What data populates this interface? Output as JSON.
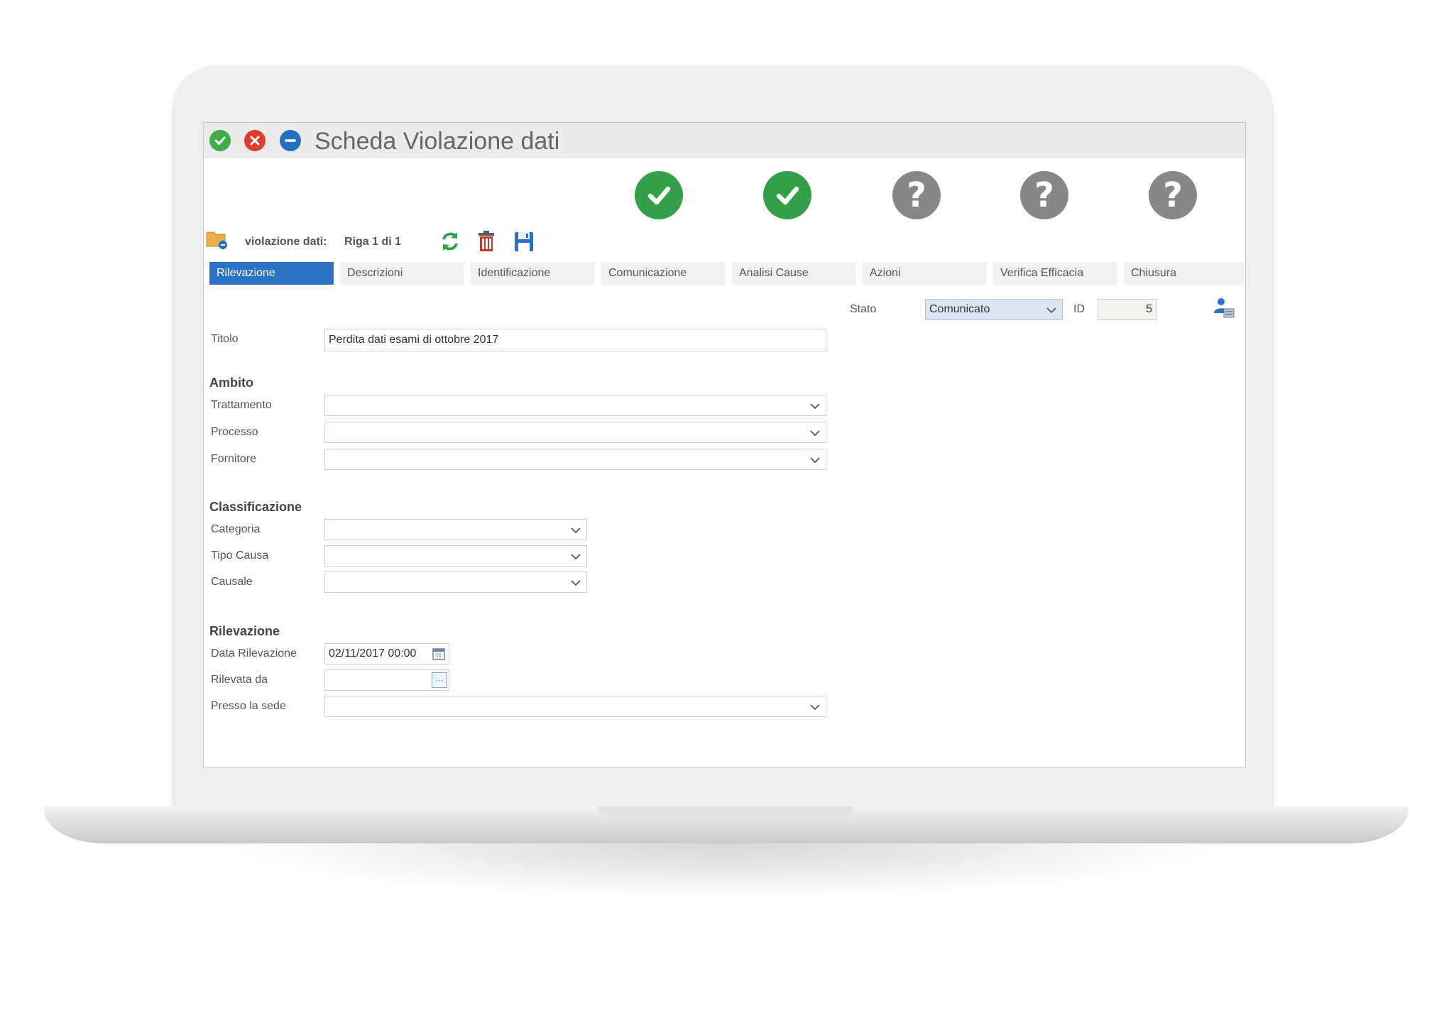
{
  "window": {
    "title": "Scheda Violazione dati"
  },
  "steps": [
    {
      "status": "done",
      "icon": "check-icon"
    },
    {
      "status": "done",
      "icon": "check-icon"
    },
    {
      "status": "todo",
      "icon": "question-icon",
      "glyph": "?"
    },
    {
      "status": "todo",
      "icon": "question-icon",
      "glyph": "?"
    },
    {
      "status": "todo",
      "icon": "question-icon",
      "glyph": "?"
    }
  ],
  "navigator": {
    "label": "violazione dati:",
    "record": "Riga 1 di 1"
  },
  "tabs": [
    {
      "label": "Rilevazione",
      "active": true
    },
    {
      "label": "Descrizioni",
      "active": false
    },
    {
      "label": "Identificazione",
      "active": false
    },
    {
      "label": "Comunicazione",
      "active": false
    },
    {
      "label": "Analisi Cause",
      "active": false
    },
    {
      "label": "Azioni",
      "active": false
    },
    {
      "label": "Verifica Efficacia",
      "active": false
    },
    {
      "label": "Chiusura",
      "active": false
    }
  ],
  "header_fields": {
    "stato_label": "Stato",
    "stato_value": "Comunicato",
    "id_label": "ID",
    "id_value": "5"
  },
  "form": {
    "titolo_label": "Titolo",
    "titolo_value": "Perdita dati esami di ottobre 2017",
    "ambito": {
      "heading": "Ambito",
      "trattamento_label": "Trattamento",
      "processo_label": "Processo",
      "fornitore_label": "Fornitore"
    },
    "classificazione": {
      "heading": "Classificazione",
      "categoria_label": "Categoria",
      "tipo_causa_label": "Tipo Causa",
      "causale_label": "Causale"
    },
    "rilevazione": {
      "heading": "Rilevazione",
      "data_label": "Data Rilevazione",
      "data_value": "02/11/2017 00:00",
      "rilevata_da_label": "Rilevata da",
      "presso_label": "Presso la sede"
    }
  },
  "colors": {
    "accent": "#2b72c8",
    "success": "#34a04a",
    "danger": "#de3c2f",
    "neutral": "#878787"
  }
}
